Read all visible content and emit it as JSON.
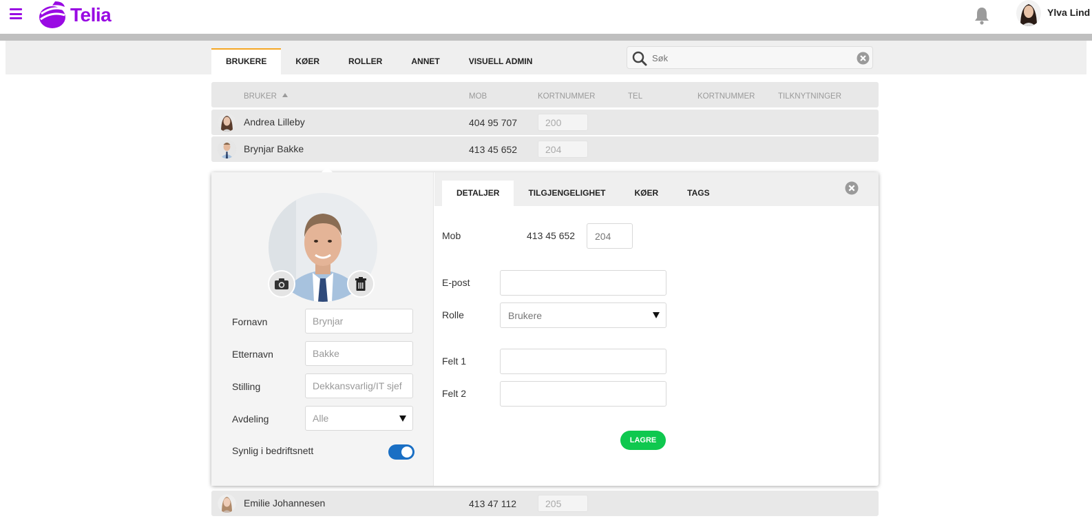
{
  "header": {
    "brand": "Telia",
    "user_name": "Ylva Lind"
  },
  "main_tabs": [
    {
      "label": "BRUKERE",
      "active": true
    },
    {
      "label": "KØER",
      "active": false
    },
    {
      "label": "ROLLER",
      "active": false
    },
    {
      "label": "ANNET",
      "active": false
    },
    {
      "label": "VISUELL ADMIN",
      "active": false
    }
  ],
  "search": {
    "placeholder": "Søk"
  },
  "table": {
    "columns": [
      "BRUKER",
      "MOB",
      "KORTNUMMER",
      "TEL",
      "KORTNUMMER",
      "TILKNYTNINGER"
    ],
    "sort_column": "BRUKER",
    "sort_direction": "ascending",
    "rows": [
      {
        "name": "Andrea Lilleby",
        "mob": "404 95 707",
        "kortnummer": "200"
      },
      {
        "name": "Brynjar Bakke",
        "mob": "413 45 652",
        "kortnummer": "204"
      },
      {
        "name": "Emilie Johannesen",
        "mob": "413 47 112",
        "kortnummer": "205"
      }
    ]
  },
  "detail": {
    "form": {
      "fornavn_label": "Fornavn",
      "fornavn_value": "Brynjar",
      "etternavn_label": "Etternavn",
      "etternavn_value": "Bakke",
      "stilling_label": "Stilling",
      "stilling_value": "Dekkansvarlig/IT sjef",
      "avdeling_label": "Avdeling",
      "avdeling_value": "Alle",
      "synlig_label": "Synlig i bedriftsnett",
      "synlig_on": true
    },
    "tabs": [
      {
        "label": "DETALJER",
        "active": true
      },
      {
        "label": "TILGJENGELIGHET",
        "active": false
      },
      {
        "label": "KØER",
        "active": false
      },
      {
        "label": "TAGS",
        "active": false
      }
    ],
    "details": {
      "mob_label": "Mob",
      "mob_value": "413 45 652",
      "kortnummer_value": "204",
      "epost_label": "E-post",
      "epost_value": "",
      "rolle_label": "Rolle",
      "rolle_value": "Brukere",
      "felt1_label": "Felt 1",
      "felt1_value": "",
      "felt2_label": "Felt 2",
      "felt2_value": "",
      "save_label": "LAGRE"
    }
  },
  "icons": [
    "menu-icon",
    "telia-logo-icon",
    "bell-icon",
    "search-icon",
    "clear-icon",
    "sort-asc-icon",
    "camera-icon",
    "trash-icon",
    "close-icon",
    "dropdown-arrow-icon"
  ],
  "colors": {
    "brand": "#990ae3",
    "tab_accent": "#f5a623",
    "toggle": "#1a6fc4",
    "save": "#0fc84f"
  }
}
